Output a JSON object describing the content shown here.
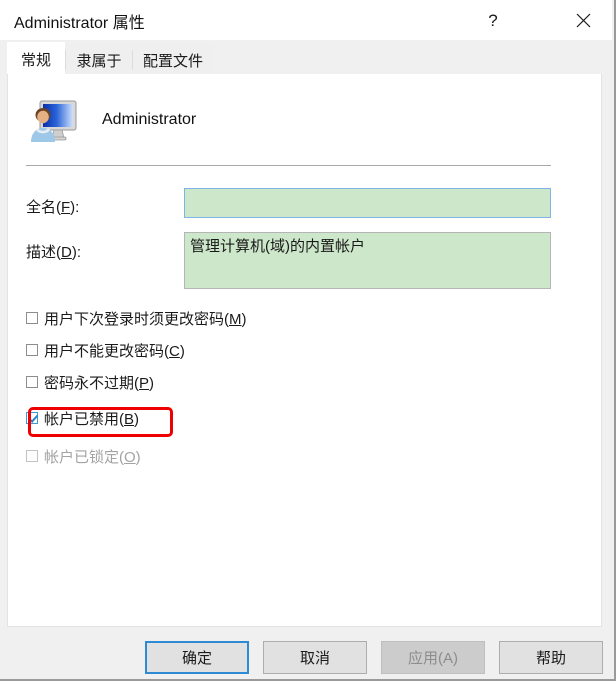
{
  "window": {
    "title": "Administrator 属性",
    "help_icon": "question-mark-icon",
    "close_icon": "close-icon"
  },
  "tabs": [
    {
      "label": "常规",
      "active": true
    },
    {
      "label": "隶属于",
      "active": false
    },
    {
      "label": "配置文件",
      "active": false
    }
  ],
  "header": {
    "icon": "user-account-icon",
    "account_name": "Administrator"
  },
  "fields": [
    {
      "label_prefix": "全名(",
      "accel": "F",
      "label_suffix": "):",
      "value": "",
      "placeholder": ""
    },
    {
      "label_prefix": "描述(",
      "accel": "D",
      "label_suffix": "):",
      "value": "管理计算机(域)的内置帐户",
      "placeholder": ""
    }
  ],
  "checkboxes": [
    {
      "label_prefix": "用户下次登录时须更改密码(",
      "accel": "M",
      "label_suffix": ")",
      "checked": false,
      "disabled": false,
      "highlighted": false
    },
    {
      "label_prefix": "用户不能更改密码(",
      "accel": "C",
      "label_suffix": ")",
      "checked": false,
      "disabled": false,
      "highlighted": false
    },
    {
      "label_prefix": "密码永不过期(",
      "accel": "P",
      "label_suffix": ")",
      "checked": false,
      "disabled": false,
      "highlighted": false
    },
    {
      "label_prefix": "帐户已禁用(",
      "accel": "B",
      "label_suffix": ")",
      "checked": true,
      "disabled": false,
      "highlighted": true
    },
    {
      "label_prefix": "帐户已锁定(",
      "accel": "O",
      "label_suffix": ")",
      "checked": false,
      "disabled": true,
      "highlighted": false
    }
  ],
  "buttons": [
    {
      "label": "确定",
      "default": true,
      "disabled": false
    },
    {
      "label": "取消",
      "default": false,
      "disabled": false
    },
    {
      "label": "应用(A)",
      "default": false,
      "disabled": true,
      "accel": "A"
    },
    {
      "label": "帮助",
      "default": false,
      "disabled": false
    }
  ],
  "colors": {
    "dialog_background": "#f0f0f0",
    "panel_background": "#ffffff",
    "field_fill": "#cde7ca",
    "focus_border": "#7cb5e4",
    "annotation_red": "#ef0000",
    "default_button_border": "#2f8ad4",
    "disabled_text": "#8d8d8d"
  }
}
